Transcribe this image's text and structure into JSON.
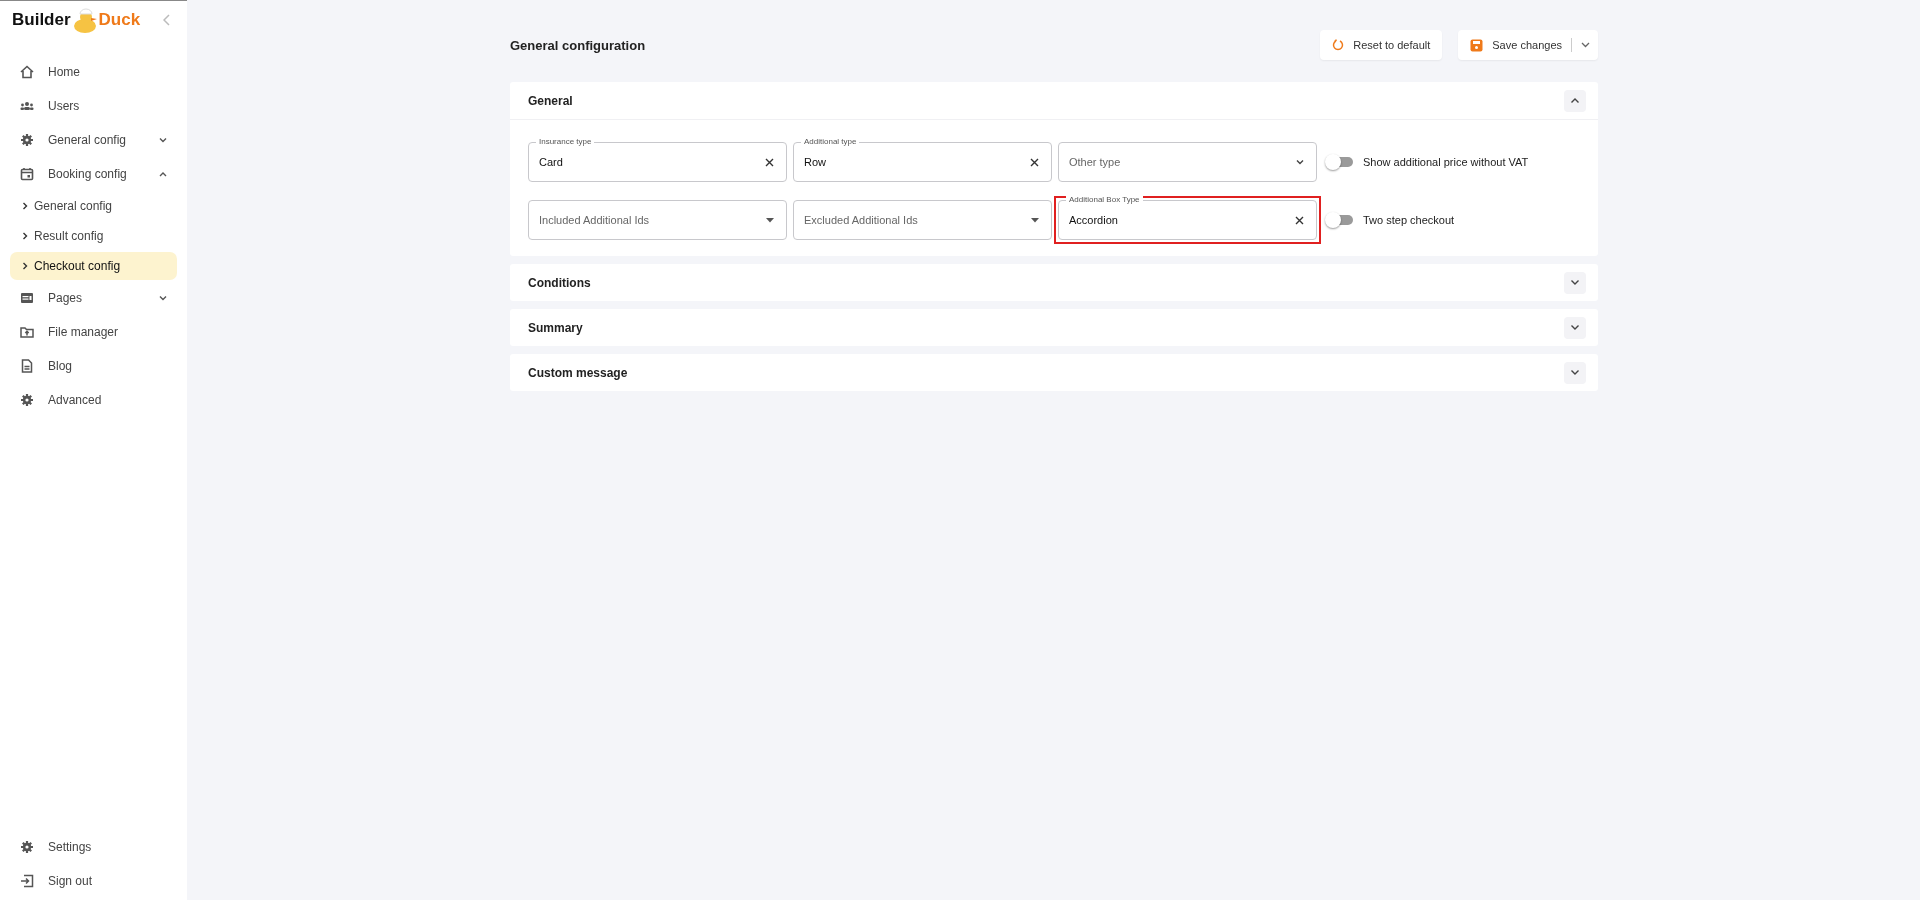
{
  "logo": {
    "part_1": "Builder",
    "part_2": "Duck"
  },
  "sidebar": {
    "items": [
      {
        "label": "Home",
        "selected": false
      },
      {
        "label": "Users",
        "selected": false
      },
      {
        "label": "General config",
        "selected": false,
        "expanded": false
      },
      {
        "label": "Booking config",
        "selected": false,
        "expanded": true,
        "children": [
          {
            "label": "General config",
            "selected": false
          },
          {
            "label": "Result config",
            "selected": false
          },
          {
            "label": "Checkout config",
            "selected": true
          }
        ]
      },
      {
        "label": "Pages",
        "selected": false,
        "expanded": false
      },
      {
        "label": "File manager",
        "selected": false
      },
      {
        "label": "Blog",
        "selected": false
      },
      {
        "label": "Advanced",
        "selected": false
      }
    ],
    "footer": [
      {
        "label": "Settings"
      },
      {
        "label": "Sign out"
      }
    ]
  },
  "page": {
    "title": "General configuration",
    "buttons": [
      {
        "label": "Reset to default",
        "kind": "reset"
      },
      {
        "label": "Save changes",
        "kind": "save"
      }
    ]
  },
  "sections": [
    {
      "title": "General",
      "expanded": true,
      "fields": [
        {
          "kind": "clear",
          "label": "Insurance type",
          "value": "Card",
          "highlighted": false
        },
        {
          "kind": "clear",
          "label": "Additional type",
          "value": "Row",
          "highlighted": false
        },
        {
          "kind": "chevron",
          "placeholder": "Other type",
          "highlighted": false
        },
        {
          "kind": "caret",
          "placeholder": "Included Additional Ids",
          "highlighted": false
        },
        {
          "kind": "caret",
          "placeholder": "Excluded Additional Ids",
          "highlighted": false
        },
        {
          "kind": "clear",
          "label": "Additional Box Type",
          "value": "Accordion",
          "highlighted": true
        }
      ],
      "toggles": [
        {
          "label": "Show additional price without VAT",
          "on": false
        },
        {
          "label": "Two step checkout",
          "on": false
        }
      ]
    },
    {
      "title": "Conditions",
      "expanded": false
    },
    {
      "title": "Summary",
      "expanded": false
    },
    {
      "title": "Custom message",
      "expanded": false
    }
  ]
}
